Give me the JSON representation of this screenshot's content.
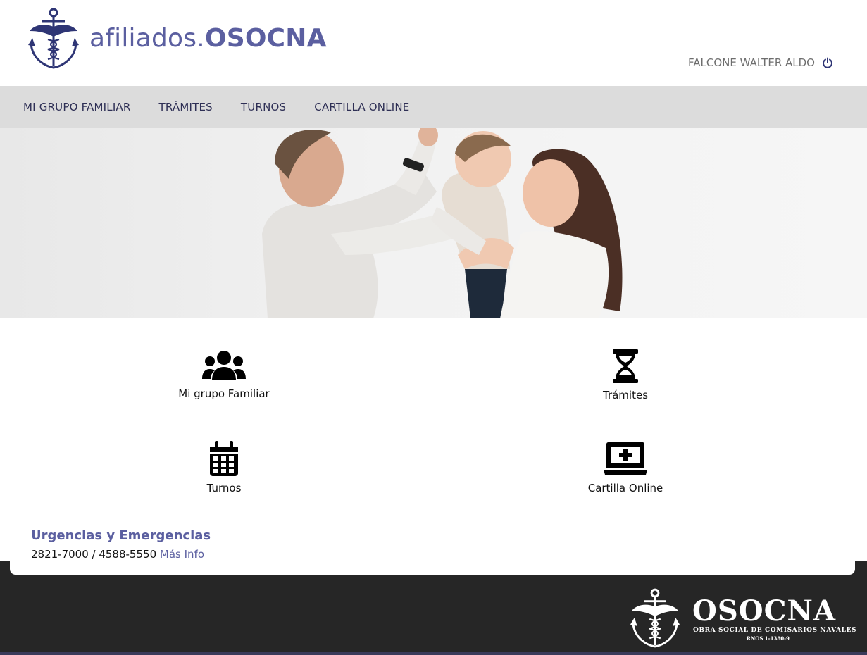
{
  "header": {
    "brand_prefix": "afiliados.",
    "brand_name": "OSOCNA",
    "user_name": "FALCONE WALTER ALDO",
    "logo_icon": "anchor-caduceus-logo",
    "logout_icon": "power-icon",
    "brand_color": "#5b5fa0"
  },
  "nav": {
    "items": [
      {
        "label": "MI GRUPO FAMILIAR"
      },
      {
        "label": "TRÁMITES"
      },
      {
        "label": "TURNOS"
      },
      {
        "label": "CARTILLA ONLINE"
      }
    ]
  },
  "hero": {
    "image": "family-photo"
  },
  "tiles": [
    {
      "label": "Mi grupo Familiar",
      "icon": "users-icon"
    },
    {
      "label": "Trámites",
      "icon": "hourglass-icon"
    },
    {
      "label": "Turnos",
      "icon": "calendar-icon"
    },
    {
      "label": "Cartilla Online",
      "icon": "laptop-medical-icon"
    }
  ],
  "emergency": {
    "title": "Urgencias y Emergencias",
    "phones": "2821-7000 / 4588-5550",
    "link_label": "Más Info"
  },
  "footer": {
    "brand": "OSOCNA",
    "subtitle": "OBRA SOCIAL DE COMISARIOS NAVALES",
    "rnos": "RNOS 1-1380-9",
    "background": "#262626"
  }
}
